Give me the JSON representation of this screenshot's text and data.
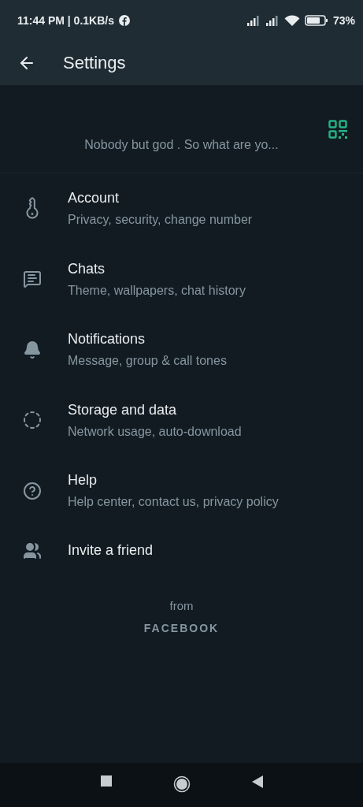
{
  "status_bar": {
    "time": "11:44 PM | 0.1KB/s",
    "battery": "73%"
  },
  "app_bar": {
    "title": "Settings"
  },
  "profile": {
    "status": "Nobody but god . So what are yo..."
  },
  "items": [
    {
      "title": "Account",
      "subtitle": "Privacy, security, change number"
    },
    {
      "title": "Chats",
      "subtitle": "Theme, wallpapers, chat history"
    },
    {
      "title": "Notifications",
      "subtitle": "Message, group & call tones"
    },
    {
      "title": "Storage and data",
      "subtitle": "Network usage, auto-download"
    },
    {
      "title": "Help",
      "subtitle": "Help center, contact us, privacy policy"
    },
    {
      "title": "Invite a friend"
    }
  ],
  "footer": {
    "from": "from",
    "brand": "FACEBOOK"
  }
}
